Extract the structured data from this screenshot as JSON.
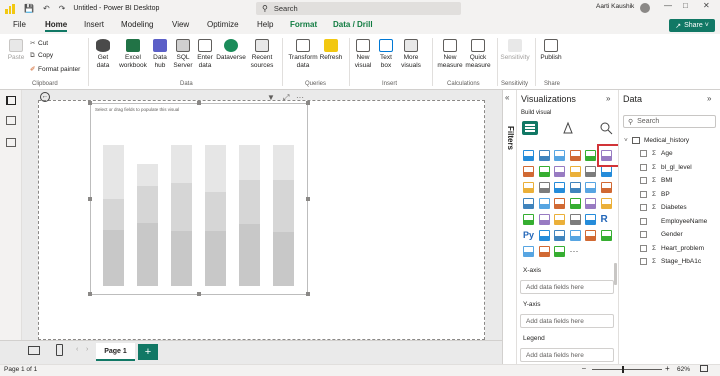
{
  "titlebar": {
    "title": "Untitled - Power BI Desktop",
    "search": "Search",
    "user": "Aarti Kaushik"
  },
  "menu": {
    "tabs": [
      "File",
      "Home",
      "Insert",
      "Modeling",
      "View",
      "Optimize",
      "Help",
      "Format",
      "Data / Drill"
    ],
    "active": "Home",
    "share": "Share"
  },
  "ribbon": {
    "paste": "Paste",
    "cut": "Cut",
    "copy": "Copy",
    "format_painter": "Format painter",
    "get_data": "Get data",
    "excel_workbook": "Excel workbook",
    "data_hub": "Data hub",
    "sql_server": "SQL Server",
    "enter_data": "Enter data",
    "dataverse": "Dataverse",
    "recent_sources": "Recent sources",
    "transform_data": "Transform data",
    "refresh": "Refresh",
    "new_visual": "New visual",
    "text_box": "Text box",
    "more_visuals": "More visuals",
    "new_measure": "New measure",
    "quick_measure": "Quick measure",
    "sensitivity": "Sensitivity",
    "publish": "Publish",
    "groups": {
      "clipboard": "Clipboard",
      "data": "Data",
      "queries": "Queries",
      "insert": "Insert",
      "calculations": "Calculations",
      "sensitivity": "Sensitivity",
      "share": "Share"
    }
  },
  "visual": {
    "hint": "Select or drag fields to populate this visual"
  },
  "filters": {
    "label": "Filters"
  },
  "visualizations": {
    "title": "Visualizations",
    "build_visual": "Build visual",
    "wells": [
      {
        "label": "X-axis",
        "placeholder": "Add data fields here"
      },
      {
        "label": "Y-axis",
        "placeholder": "Add data fields here"
      },
      {
        "label": "Legend",
        "placeholder": "Add data fields here"
      }
    ],
    "icon_rows": [
      [
        "stacked-bar-chart-icon",
        "stacked-column-chart-icon",
        "clustered-bar-chart-icon",
        "clustered-column-chart-icon",
        "100-percent-stacked-bar-chart-icon",
        "100-percent-stacked-column-chart-icon"
      ],
      [
        "line-chart-icon",
        "area-chart-icon",
        "stacked-area-chart-icon",
        "line-and-stacked-column-chart-icon",
        "line-and-clustered-column-chart-icon",
        "ribbon-chart-icon"
      ],
      [
        "waterfall-chart-icon",
        "funnel-chart-icon",
        "scatter-chart-icon",
        "pie-chart-icon",
        "donut-chart-icon",
        "treemap-icon"
      ],
      [
        "map-icon",
        "filled-map-icon",
        "shape-map-icon",
        "azure-map-icon",
        "gauge-icon",
        "card-icon"
      ],
      [
        "multi-row-card-icon",
        "kpi-icon",
        "slicer-icon",
        "table-icon",
        "matrix-icon",
        "r-script-visual-icon"
      ],
      [
        "python-visual-icon",
        "key-influencers-icon",
        "decomposition-tree-icon",
        "qa-visual-icon",
        "smart-narrative-icon",
        "paginated-report-icon"
      ],
      [
        "power-apps-icon",
        "power-automate-icon",
        "metrics-icon",
        "more-visuals-icon"
      ]
    ],
    "icon_text": {
      "r": "R",
      "py": "Py",
      "more": "···"
    }
  },
  "data": {
    "title": "Data",
    "search": "Search",
    "table": "Medical_history",
    "fields": [
      {
        "name": "Age",
        "sigma": true
      },
      {
        "name": "bl_gl_level",
        "sigma": true
      },
      {
        "name": "BMI",
        "sigma": true
      },
      {
        "name": "BP",
        "sigma": true
      },
      {
        "name": "Diabetes",
        "sigma": true
      },
      {
        "name": "EmployeeName",
        "sigma": false
      },
      {
        "name": "Gender",
        "sigma": false
      },
      {
        "name": "Heart_problem",
        "sigma": true
      },
      {
        "name": "Stage_HbA1c",
        "sigma": true
      }
    ],
    "sigma_symbol": "Σ"
  },
  "pages": {
    "tab": "Page 1",
    "add": "+"
  },
  "status": {
    "page": "Page 1 of 1",
    "zoom": "62%"
  },
  "colors": {
    "accent": "#117865",
    "highlight": "#d13438",
    "pbi_yellow": "#f2c811"
  }
}
